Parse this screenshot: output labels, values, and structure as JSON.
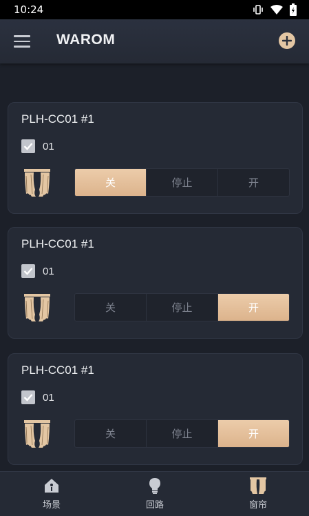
{
  "status_bar": {
    "time": "10:24",
    "icons": [
      "vibrate-icon",
      "wifi-icon",
      "battery-charging-icon"
    ]
  },
  "app_bar": {
    "title": "WAROM",
    "menu_icon": "hamburger-menu-icon",
    "add_icon": "add-circle-icon"
  },
  "colors": {
    "accent": "#e3c6a3",
    "background": "#1c2029",
    "card": "#252a35"
  },
  "devices": [
    {
      "title": "PLH-CC01 #1",
      "checkbox_label": "01",
      "checked": true,
      "icon": "curtain-icon",
      "controls": [
        "关",
        "停止",
        "开"
      ],
      "active": "关"
    },
    {
      "title": "PLH-CC01 #1",
      "checkbox_label": "01",
      "checked": true,
      "icon": "curtain-icon",
      "controls": [
        "关",
        "停止",
        "开"
      ],
      "active": "开"
    },
    {
      "title": "PLH-CC01 #1",
      "checkbox_label": "01",
      "checked": true,
      "icon": "curtain-icon",
      "controls": [
        "关",
        "停止",
        "开"
      ],
      "active": "开"
    }
  ],
  "bottom_nav": {
    "items": [
      {
        "label": "场景",
        "icon": "scene-house-icon"
      },
      {
        "label": "回路",
        "icon": "lightbulb-icon"
      },
      {
        "label": "窗帘",
        "icon": "curtain-icon",
        "selected": true
      }
    ]
  }
}
